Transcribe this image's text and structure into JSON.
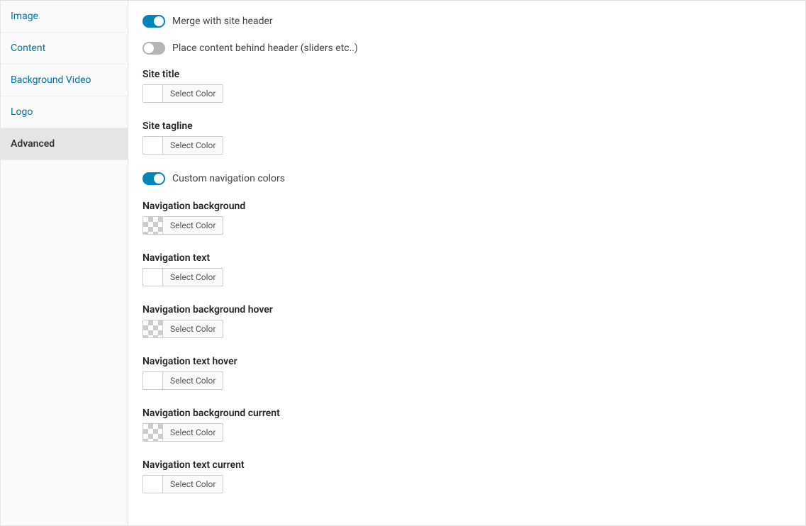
{
  "sidebar": {
    "items": [
      {
        "label": "Image",
        "active": false
      },
      {
        "label": "Content",
        "active": false
      },
      {
        "label": "Background Video",
        "active": false
      },
      {
        "label": "Logo",
        "active": false
      },
      {
        "label": "Advanced",
        "active": true
      }
    ]
  },
  "settings": {
    "merge_header": {
      "label": "Merge with site header",
      "on": true
    },
    "place_behind": {
      "label": "Place content behind header (sliders etc..)",
      "on": false
    },
    "site_title": {
      "label": "Site title",
      "select_color": "Select Color",
      "swatch": "white"
    },
    "site_tagline": {
      "label": "Site tagline",
      "select_color": "Select Color",
      "swatch": "white"
    },
    "custom_nav_colors": {
      "label": "Custom navigation colors",
      "on": true
    },
    "nav_bg": {
      "label": "Navigation background",
      "select_color": "Select Color",
      "swatch": "transparent"
    },
    "nav_text": {
      "label": "Navigation text",
      "select_color": "Select Color",
      "swatch": "white"
    },
    "nav_bg_hover": {
      "label": "Navigation background hover",
      "select_color": "Select Color",
      "swatch": "transparent"
    },
    "nav_text_hover": {
      "label": "Navigation text hover",
      "select_color": "Select Color",
      "swatch": "white"
    },
    "nav_bg_current": {
      "label": "Navigation background current",
      "select_color": "Select Color",
      "swatch": "transparent"
    },
    "nav_text_current": {
      "label": "Navigation text current",
      "select_color": "Select Color",
      "swatch": "white"
    }
  }
}
